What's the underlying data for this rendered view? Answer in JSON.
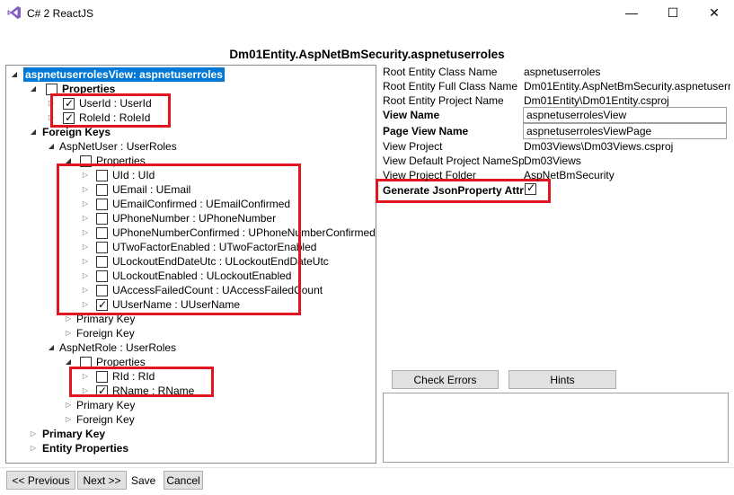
{
  "window": {
    "title": "C# 2 ReactJS",
    "minimize": "—",
    "maximize": "☐",
    "close": "✕"
  },
  "header": {
    "title": "Dm01Entity.AspNetBmSecurity.aspnetuserroles"
  },
  "tree": {
    "root": "aspnetuserrolesView: aspnetuserroles",
    "properties": "Properties",
    "userid": "UserId : UserId",
    "roleid": "RoleId : RoleId",
    "foreign_keys": "Foreign Keys",
    "aspnetuser": "AspNetUser : UserRoles",
    "aspnetuser_properties": "Properties",
    "user_props": [
      "UId : UId",
      "UEmail : UEmail",
      "UEmailConfirmed : UEmailConfirmed",
      "UPhoneNumber : UPhoneNumber",
      "UPhoneNumberConfirmed : UPhoneNumberConfirmed",
      "UTwoFactorEnabled : UTwoFactorEnabled",
      "ULockoutEndDateUtc : ULockoutEndDateUtc",
      "ULockoutEnabled : ULockoutEnabled",
      "UAccessFailedCount : UAccessFailedCount",
      "UUserName : UUserName"
    ],
    "aspnetuser_primary_key": "Primary Key",
    "aspnetuser_foreign_key": "Foreign Key",
    "aspnetrole": "AspNetRole : UserRoles",
    "aspnetrole_properties": "Properties",
    "role_props": [
      "RId : RId",
      "RName : RName"
    ],
    "aspnetrole_primary_key": "Primary Key",
    "aspnetrole_foreign_key": "Foreign Key",
    "primary_key": "Primary Key",
    "entity_properties": "Entity Properties"
  },
  "details": {
    "root_entity_class_name_label": "Root Entity Class Name",
    "root_entity_class_name": "aspnetuserroles",
    "root_entity_full_class_name_label": "Root Entity Full Class Name",
    "root_entity_full_class_name": "Dm01Entity.AspNetBmSecurity.aspnetuserro",
    "root_entity_project_name_label": "Root Entity Project Name",
    "root_entity_project_name": "Dm01Entity\\Dm01Entity.csproj",
    "view_name_label": "View Name",
    "view_name": "aspnetuserrolesView",
    "page_view_name_label": "Page View Name",
    "page_view_name": "aspnetuserrolesViewPage",
    "view_project_label": "View Project",
    "view_project": "Dm03Views\\Dm03Views.csproj",
    "view_default_project_namespace_label": "View Default Project NameSp",
    "view_default_project_namespace": "Dm03Views",
    "view_project_folder_label": "View Project Folder",
    "view_project_folder": "AspNetBmSecurity",
    "generate_jsonproperty_label": "Generate JsonProperty Attri"
  },
  "buttons": {
    "check_errors": "Check Errors",
    "hints": "Hints",
    "previous": "<< Previous",
    "next": "Next >>",
    "save": "Save",
    "cancel": "Cancel"
  },
  "colors": {
    "highlight_box": "#e0151f",
    "selection": "#0078d7",
    "app_icon": "#865fc5"
  }
}
